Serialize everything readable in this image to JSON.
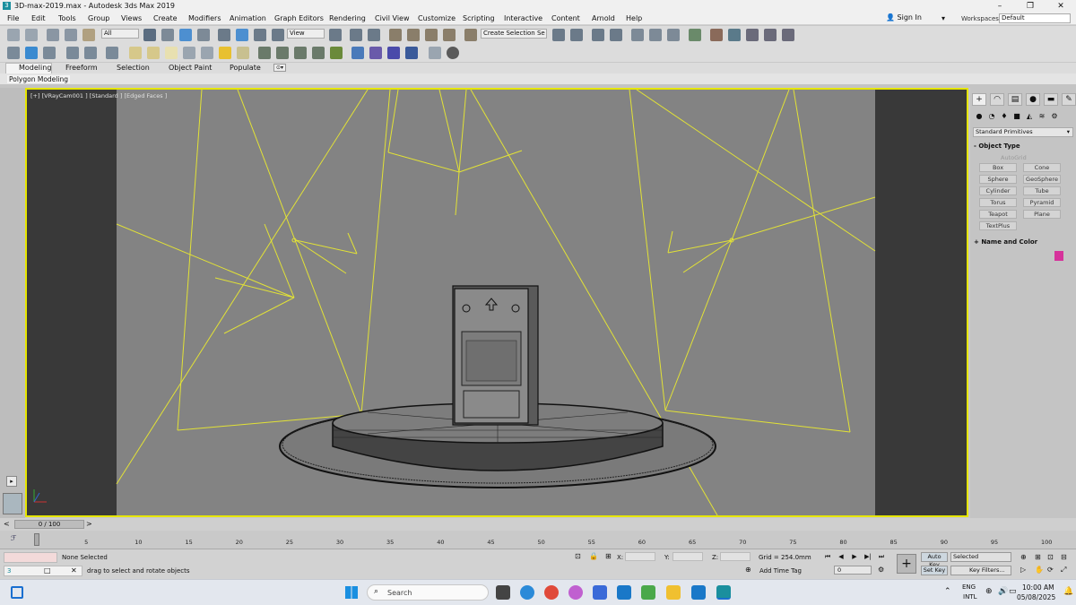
{
  "window": {
    "title": "3D-max-2019.max - Autodesk 3ds Max 2019",
    "controls": [
      "–",
      "❐",
      "✕"
    ]
  },
  "menu": {
    "items": [
      "File",
      "Edit",
      "Tools",
      "Group",
      "Views",
      "Create",
      "Modifiers",
      "Animation",
      "Graph Editors",
      "Rendering",
      "Civil View",
      "Customize",
      "Scripting",
      "Interactive",
      "Content",
      "Arnold",
      "Help"
    ],
    "sign_in": "Sign In",
    "workspaces_label": "Workspaces:",
    "workspaces_value": "Default"
  },
  "toolbar": {
    "filter_value": "All",
    "view_value": "View",
    "create_selection_set": "Create Selection Se"
  },
  "ribbon": {
    "tabs": [
      "Modeling",
      "Freeform",
      "Selection",
      "Object Paint",
      "Populate"
    ],
    "sub_label": "Polygon Modeling"
  },
  "viewport": {
    "label": "[+] [VRayCam001 ] [Standard ] [Edged Faces ]",
    "border_color": "#e6e600",
    "background": "#838383",
    "side_color": "#393939"
  },
  "command_panel": {
    "category": "Standard Primitives",
    "object_type_title": "Object Type",
    "autogrid": "AutoGrid",
    "buttons": [
      "Box",
      "Cone",
      "Sphere",
      "GeoSphere",
      "Cylinder",
      "Tube",
      "Torus",
      "Pyramid",
      "Teapot",
      "Plane",
      "TextPlus"
    ],
    "name_color_title": "Name and Color",
    "swatch_color": "#d6339b"
  },
  "timeline": {
    "frame_display": "0 / 100",
    "ticks": [
      "0",
      "5",
      "10",
      "15",
      "20",
      "25",
      "30",
      "35",
      "40",
      "45",
      "50",
      "55",
      "60",
      "65",
      "70",
      "75",
      "80",
      "85",
      "90",
      "95",
      "100"
    ]
  },
  "status": {
    "selection": "None Selected",
    "hint": "drag to select and rotate objects",
    "x_label": "X:",
    "y_label": "Y:",
    "z_label": "Z:",
    "grid": "Grid = 254.0mm",
    "add_time_tag": "Add Time Tag",
    "auto_key": "Auto Key",
    "set_key": "Set Key",
    "selected": "Selected",
    "key_filters": "Key Filters...",
    "frame_value": "0"
  },
  "taskbar": {
    "search": "Search",
    "lang1": "ENG",
    "lang2": "INTL",
    "time": "10:00 AM",
    "date": "05/08/2025"
  }
}
